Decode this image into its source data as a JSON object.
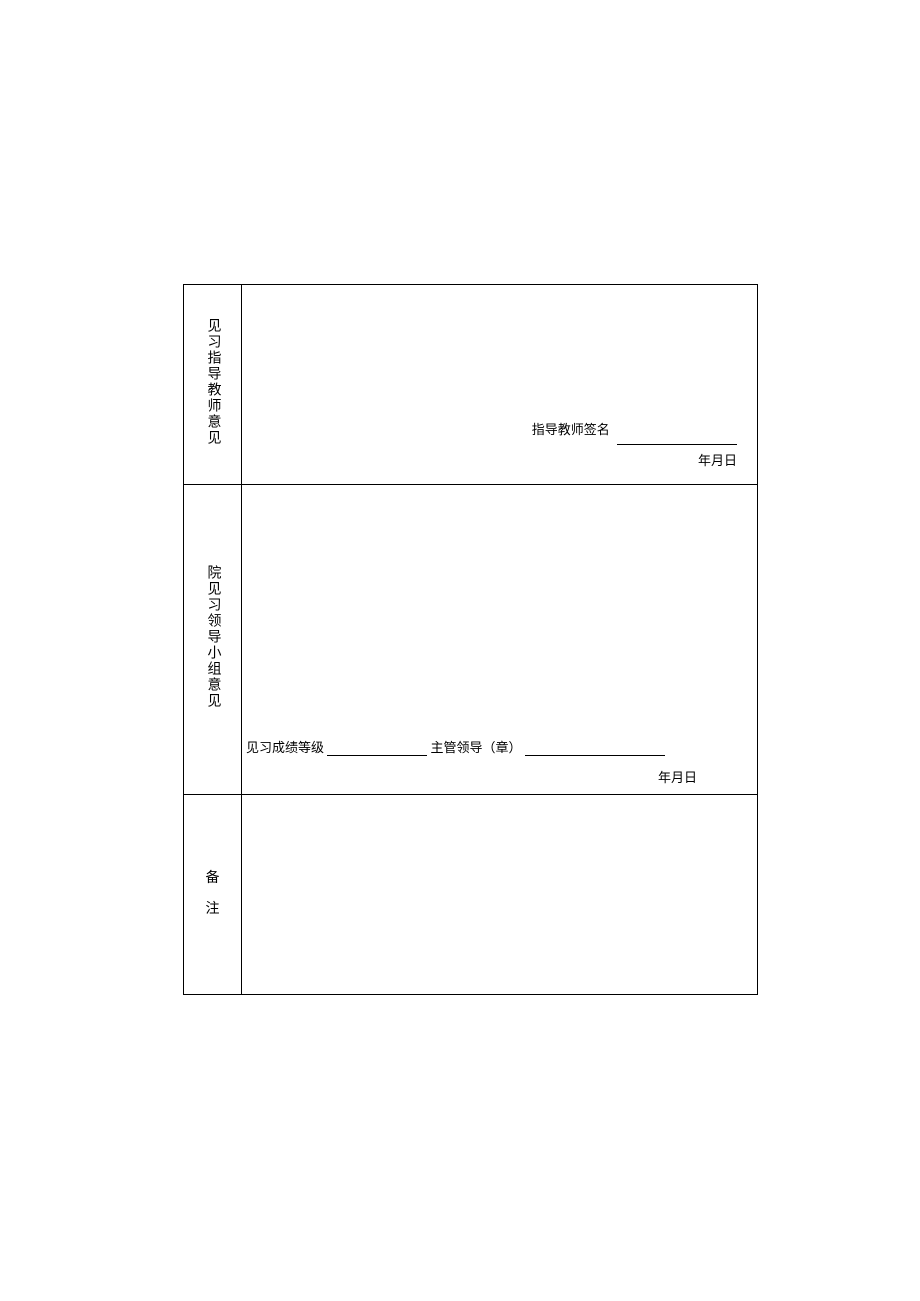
{
  "rows": {
    "row1": {
      "label": "见习指导教师意见",
      "signature_label": "指导教师签名",
      "date_label": "年月日"
    },
    "row2": {
      "label": "院见习领导小组意见",
      "grade_label": "见习成绩等级",
      "leader_label": "主管领导（章）",
      "date_label": "年月日"
    },
    "row3": {
      "label_char1": "备",
      "label_char2": "注"
    }
  }
}
